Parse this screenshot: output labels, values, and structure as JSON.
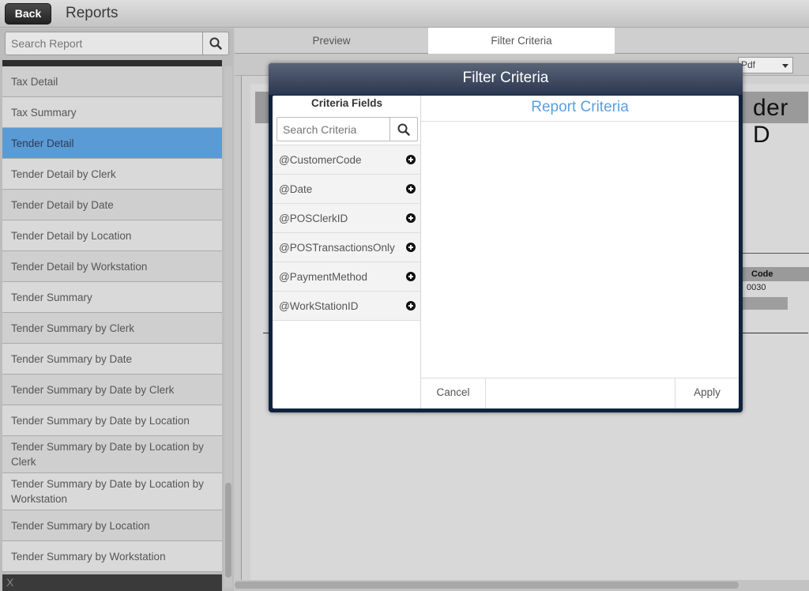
{
  "header": {
    "back_label": "Back",
    "title": "Reports"
  },
  "sidebar": {
    "search_placeholder": "Search Report",
    "items": [
      {
        "label": "Tax Detail"
      },
      {
        "label": "Tax Summary"
      },
      {
        "label": "Tender Detail"
      },
      {
        "label": "Tender Detail by Clerk"
      },
      {
        "label": "Tender Detail by Date"
      },
      {
        "label": "Tender Detail by Location"
      },
      {
        "label": "Tender Detail by Workstation"
      },
      {
        "label": "Tender Summary"
      },
      {
        "label": "Tender Summary by Clerk"
      },
      {
        "label": "Tender Summary by Date"
      },
      {
        "label": "Tender Summary by Date by Clerk"
      },
      {
        "label": "Tender Summary by Date by Location"
      },
      {
        "label": "Tender Summary by Date by Location by Clerk"
      },
      {
        "label": "Tender Summary by Date by Location by Workstation"
      },
      {
        "label": "Tender Summary by Location"
      },
      {
        "label": "Tender Summary by Workstation"
      }
    ],
    "selected_item": "Tender Detail",
    "footer_label": "X"
  },
  "tabs": {
    "preview": "Preview",
    "filter_criteria": "Filter Criteria",
    "active": "Filter Criteria"
  },
  "toolbar": {
    "export_format": "Pdf"
  },
  "document": {
    "title_fragment": "der D",
    "column_header_fragment": "Code",
    "value_fragment": "0030"
  },
  "modal": {
    "title": "Filter Criteria",
    "criteria_fields_heading": "Criteria Fields",
    "criteria_search_placeholder": "Search Criteria",
    "criteria_fields": [
      "@CustomerCode",
      "@Date",
      "@POSClerkID",
      "@POSTransactionsOnly",
      "@PaymentMethod",
      "@WorkStationID"
    ],
    "report_criteria_heading": "Report Criteria",
    "cancel_label": "Cancel",
    "apply_label": "Apply"
  },
  "colors": {
    "accent_blue": "#5aa0e0",
    "selected_item": "#5b9bd5",
    "modal_frame": "#0f2340"
  }
}
